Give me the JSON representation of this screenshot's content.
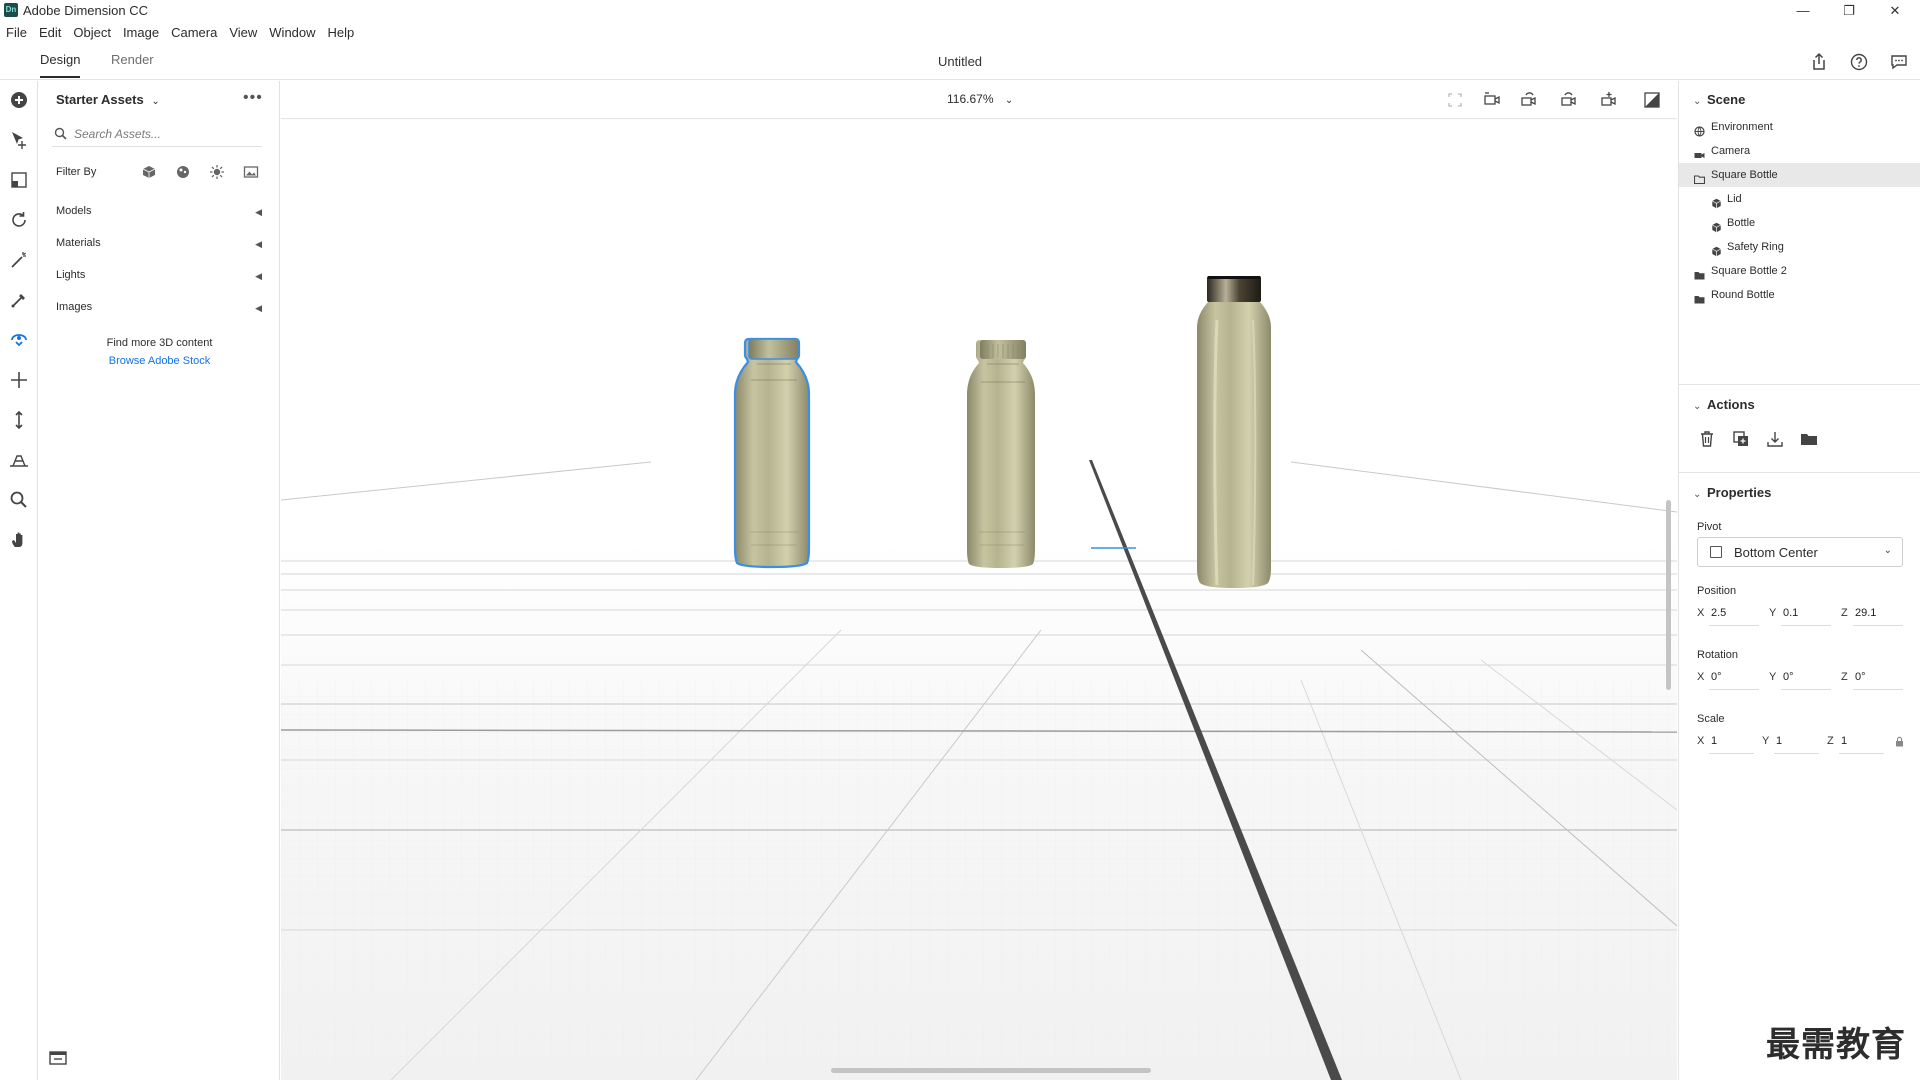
{
  "window": {
    "app_title": "Adobe Dimension CC",
    "logo_text": "Dn",
    "controls": {
      "minimize": "—",
      "restore": "❐",
      "close": "✕"
    }
  },
  "menu": [
    "File",
    "Edit",
    "Object",
    "Image",
    "Camera",
    "View",
    "Window",
    "Help"
  ],
  "tabs": {
    "design": "Design",
    "render": "Render"
  },
  "document_title": "Untitled",
  "assets_panel": {
    "title": "Starter Assets",
    "search_placeholder": "Search Assets...",
    "filter_label": "Filter By",
    "sections": [
      "Models",
      "Materials",
      "Lights",
      "Images"
    ],
    "find_more": "Find more 3D content",
    "stock_link": "Browse Adobe Stock"
  },
  "viewport": {
    "zoom": "116.67%"
  },
  "scene_panel": {
    "title": "Scene",
    "items": [
      {
        "label": "Environment",
        "icon": "globe-icon",
        "level": 0,
        "selected": false
      },
      {
        "label": "Camera",
        "icon": "camera-icon",
        "level": 0,
        "selected": false
      },
      {
        "label": "Square Bottle",
        "icon": "folder-open-icon",
        "level": 0,
        "selected": true
      },
      {
        "label": "Lid",
        "icon": "model-icon",
        "level": 1,
        "selected": false
      },
      {
        "label": "Bottle",
        "icon": "model-icon",
        "level": 1,
        "selected": false
      },
      {
        "label": "Safety Ring",
        "icon": "model-icon",
        "level": 1,
        "selected": false
      },
      {
        "label": "Square Bottle 2",
        "icon": "folder-icon",
        "level": 0,
        "selected": false
      },
      {
        "label": "Round Bottle",
        "icon": "folder-icon",
        "level": 0,
        "selected": false
      }
    ]
  },
  "actions_panel": {
    "title": "Actions",
    "icons": [
      "delete-icon",
      "duplicate-icon",
      "import-icon",
      "group-icon"
    ]
  },
  "properties_panel": {
    "title": "Properties",
    "pivot_label": "Pivot",
    "pivot_value": "Bottom Center",
    "position_label": "Position",
    "position": {
      "x": "2.5",
      "y": "0.1",
      "z": "29.1"
    },
    "rotation_label": "Rotation",
    "rotation": {
      "x": "0°",
      "y": "0°",
      "z": "0°"
    },
    "scale_label": "Scale",
    "scale": {
      "x": "1",
      "y": "1",
      "z": "1"
    }
  },
  "watermark": "最需教育",
  "colors": {
    "accent": "#1473e6",
    "selection": "#3a8ee6",
    "bottle": "#b9b78e"
  }
}
